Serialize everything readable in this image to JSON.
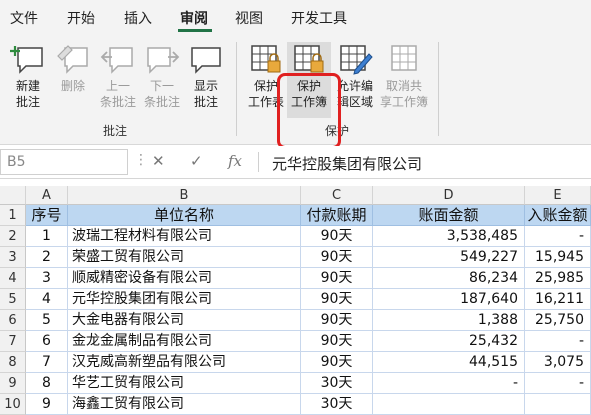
{
  "menu": {
    "items": [
      "文件",
      "开始",
      "插入",
      "审阅",
      "视图",
      "开发工具"
    ],
    "active_index": 3
  },
  "ribbon": {
    "groups": {
      "comments": "批注",
      "protect": "保护"
    },
    "buttons": {
      "new_comment": {
        "line1": "新建",
        "line2": "批注"
      },
      "delete": {
        "line1": "删除"
      },
      "prev_comment": {
        "line1": "上一",
        "line2": "条批注"
      },
      "next_comment": {
        "line1": "下一",
        "line2": "条批注"
      },
      "show_comment": {
        "line1": "显示",
        "line2": "批注"
      },
      "protect_sheet": {
        "line1": "保护",
        "line2": "工作表"
      },
      "protect_workbook": {
        "line1": "保护",
        "line2": "工作簿"
      },
      "allow_edit_ranges": {
        "line1": "允许编",
        "line2": "辑区域"
      },
      "unshare_workbook": {
        "line1": "取消共",
        "line2": "享工作簿"
      }
    }
  },
  "formula_bar": {
    "name_box": "B5",
    "cancel_symbol": "✕",
    "enter_symbol": "✓",
    "fx_symbol": "fx",
    "content": "元华控股集团有限公司"
  },
  "sheet": {
    "columns": [
      "A",
      "B",
      "C",
      "D",
      "E"
    ],
    "row_numbers": [
      "1",
      "2",
      "3",
      "4",
      "5",
      "6",
      "7",
      "8",
      "9",
      "10"
    ],
    "headers": [
      "序号",
      "单位名称",
      "付款账期",
      "账面金额",
      "入账金额"
    ],
    "rows": [
      [
        "1",
        "波瑞工程材料有限公司",
        "90天",
        "3,538,485",
        "-"
      ],
      [
        "2",
        "荣盛工贸有限公司",
        "90天",
        "549,227",
        "15,945"
      ],
      [
        "3",
        "顺威精密设备有限公司",
        "90天",
        "86,234",
        "25,985"
      ],
      [
        "4",
        "元华控股集团有限公司",
        "90天",
        "187,640",
        "16,211"
      ],
      [
        "5",
        "大金电器有限公司",
        "90天",
        "1,388",
        "25,750"
      ],
      [
        "6",
        "金龙金属制品有限公司",
        "90天",
        "25,432",
        "-"
      ],
      [
        "7",
        "汉克威高新塑品有限公司",
        "90天",
        "44,515",
        "3,075"
      ],
      [
        "8",
        "华艺工贸有限公司",
        "30天",
        "-",
        "-"
      ],
      [
        "9",
        "海鑫工贸有限公司",
        "30天",
        "",
        ""
      ]
    ]
  },
  "colors": {
    "accent": "#217346",
    "header_fill": "#bdd7f1",
    "highlight": "#e02020"
  }
}
